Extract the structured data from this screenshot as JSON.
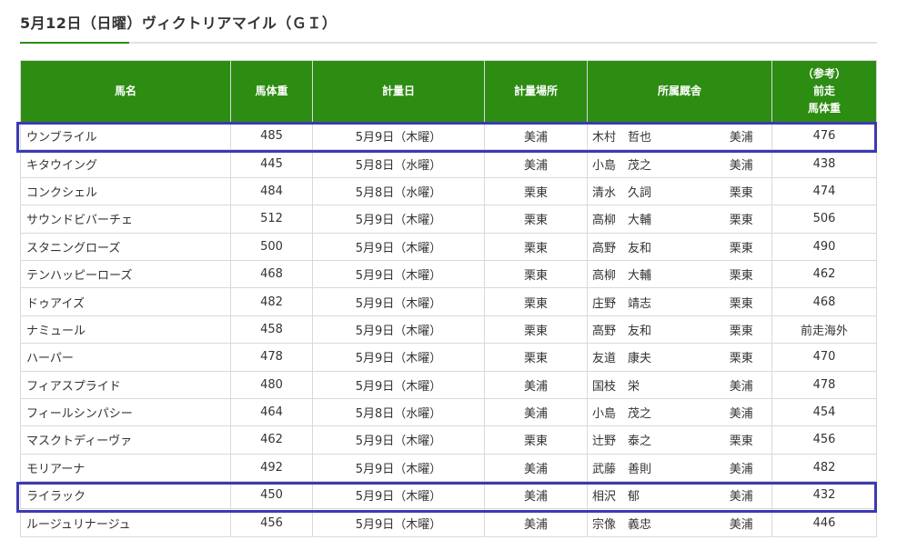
{
  "title": "5月12日（日曜）ヴィクトリアマイル（ＧＩ）",
  "colors": {
    "header_bg": "#2d8c12",
    "highlight_border": "#3a3ab4"
  },
  "columns": {
    "name": "馬名",
    "weight": "馬体重",
    "date": "計量日",
    "place": "計量場所",
    "stable": "所属厩舎",
    "prev_line1": "（参考）",
    "prev_line2": "前走",
    "prev_line3": "馬体重"
  },
  "rows": [
    {
      "name": "ウンブライル",
      "weight": "485",
      "date": "5月9日（木曜）",
      "place": "美浦",
      "trainer": "木村　哲也",
      "stable": "美浦",
      "prev": "476",
      "highlighted": true
    },
    {
      "name": "キタウイング",
      "weight": "445",
      "date": "5月8日（水曜）",
      "place": "美浦",
      "trainer": "小島　茂之",
      "stable": "美浦",
      "prev": "438"
    },
    {
      "name": "コンクシェル",
      "weight": "484",
      "date": "5月8日（水曜）",
      "place": "栗東",
      "trainer": "清水　久詞",
      "stable": "栗東",
      "prev": "474"
    },
    {
      "name": "サウンドビバーチェ",
      "weight": "512",
      "date": "5月9日（木曜）",
      "place": "栗東",
      "trainer": "高柳　大輔",
      "stable": "栗東",
      "prev": "506"
    },
    {
      "name": "スタニングローズ",
      "weight": "500",
      "date": "5月9日（木曜）",
      "place": "栗東",
      "trainer": "高野　友和",
      "stable": "栗東",
      "prev": "490"
    },
    {
      "name": "テンハッピーローズ",
      "weight": "468",
      "date": "5月9日（木曜）",
      "place": "栗東",
      "trainer": "高柳　大輔",
      "stable": "栗東",
      "prev": "462"
    },
    {
      "name": "ドゥアイズ",
      "weight": "482",
      "date": "5月9日（木曜）",
      "place": "栗東",
      "trainer": "庄野　靖志",
      "stable": "栗東",
      "prev": "468"
    },
    {
      "name": "ナミュール",
      "weight": "458",
      "date": "5月9日（木曜）",
      "place": "栗東",
      "trainer": "高野　友和",
      "stable": "栗東",
      "prev": "前走海外"
    },
    {
      "name": "ハーパー",
      "weight": "478",
      "date": "5月9日（木曜）",
      "place": "栗東",
      "trainer": "友道　康夫",
      "stable": "栗東",
      "prev": "470"
    },
    {
      "name": "フィアスプライド",
      "weight": "480",
      "date": "5月9日（木曜）",
      "place": "美浦",
      "trainer": "国枝　栄",
      "stable": "美浦",
      "prev": "478"
    },
    {
      "name": "フィールシンパシー",
      "weight": "464",
      "date": "5月8日（水曜）",
      "place": "美浦",
      "trainer": "小島　茂之",
      "stable": "美浦",
      "prev": "454"
    },
    {
      "name": "マスクトディーヴァ",
      "weight": "462",
      "date": "5月9日（木曜）",
      "place": "栗東",
      "trainer": "辻野　泰之",
      "stable": "栗東",
      "prev": "456"
    },
    {
      "name": "モリアーナ",
      "weight": "492",
      "date": "5月9日（木曜）",
      "place": "美浦",
      "trainer": "武藤　善則",
      "stable": "美浦",
      "prev": "482"
    },
    {
      "name": "ライラック",
      "weight": "450",
      "date": "5月9日（木曜）",
      "place": "美浦",
      "trainer": "相沢　郁",
      "stable": "美浦",
      "prev": "432",
      "highlighted": true
    },
    {
      "name": "ルージュリナージュ",
      "weight": "456",
      "date": "5月9日（木曜）",
      "place": "美浦",
      "trainer": "宗像　義忠",
      "stable": "美浦",
      "prev": "446"
    }
  ]
}
